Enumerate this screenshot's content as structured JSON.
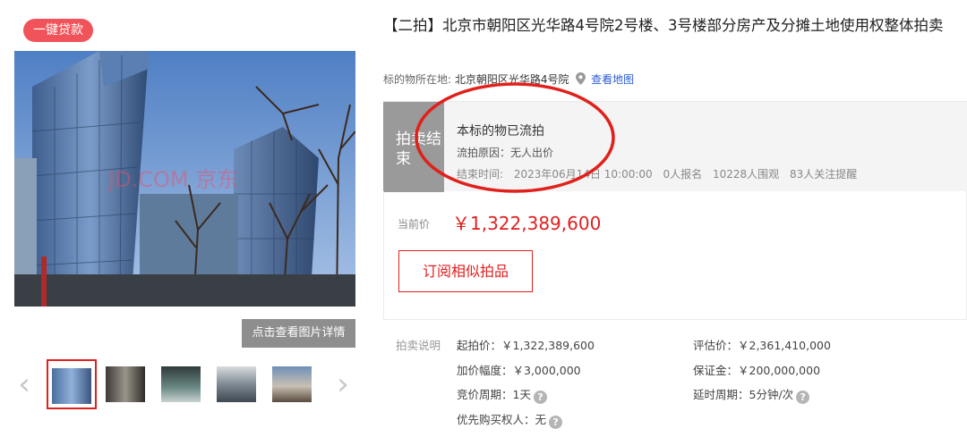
{
  "gallery": {
    "loan_badge": "一键贷款",
    "watermark": "JD.COM 京东",
    "photo_detail_button": "点击查看图片详情",
    "prev_arrow": "‹",
    "next_arrow": "›",
    "thumbnails": [
      "thumb-1",
      "thumb-2",
      "thumb-3",
      "thumb-4",
      "thumb-5"
    ]
  },
  "listing": {
    "title": "【二拍】北京市朝阳区光华路4号院2号楼、3号楼部分房产及分摊土地使用权整体拍卖",
    "location_label": "标的物所在地:",
    "location_value": "北京朝阳区光华路4号院",
    "map_link": "查看地图"
  },
  "status": {
    "tag": "拍卖结束",
    "headline": "本标的物已流拍",
    "reason": "流拍原因：无人出价",
    "end_label": "结束时间:",
    "end_time": "2023年06月14日 10:00:00",
    "signups": "0人报名",
    "views": "10228人围观",
    "watchers": "83人关注提醒"
  },
  "price": {
    "label": "当前价",
    "value": "￥1,322,389,600",
    "subscribe_button": "订阅相似拍品"
  },
  "rules": {
    "label": "拍卖说明",
    "starting_price": "起拍价：￥1,322,389,600",
    "appraisal": "评估价：￥2,361,410,000",
    "increment": "加价幅度：￥3,000,000",
    "deposit": "保证金：￥200,000,000",
    "bid_period": "竞价周期：1天",
    "extension": "延时周期：5分钟/次",
    "preemptive": "优先购买权人：无",
    "help_glyph": "?"
  },
  "colors": {
    "accent_red": "#e02020",
    "badge_red": "#f0545a",
    "status_gray": "#9a9a9a",
    "link_blue": "#2a5bd7"
  }
}
